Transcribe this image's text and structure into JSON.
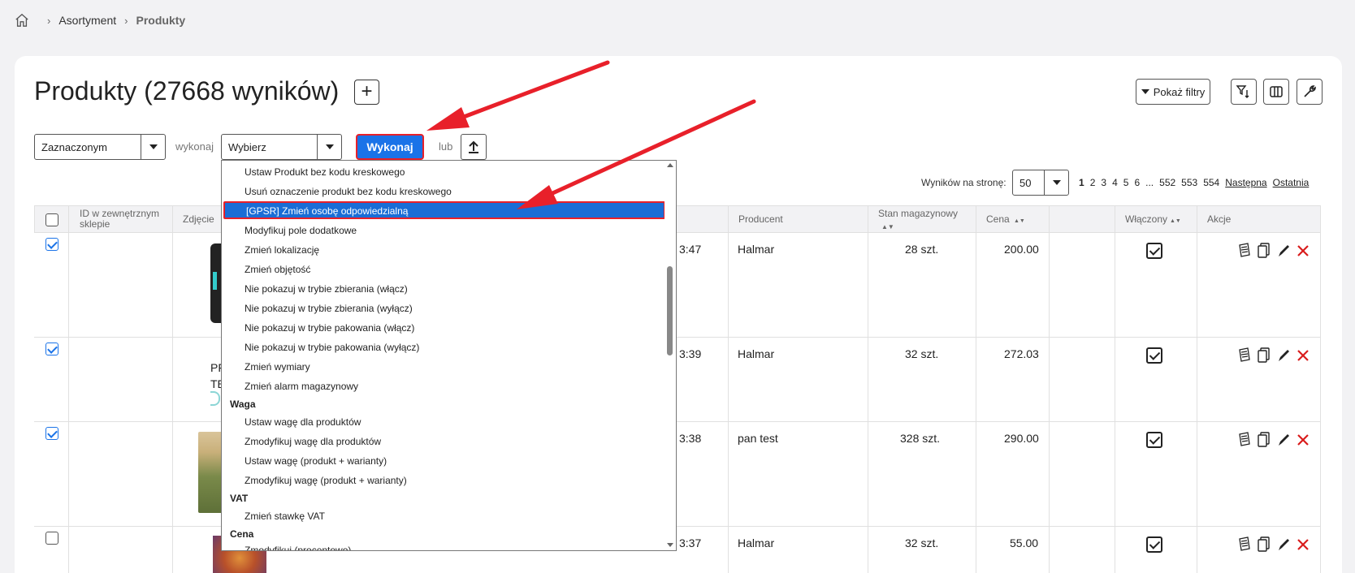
{
  "breadcrumb": {
    "items": [
      "Asortyment",
      "Produkty"
    ]
  },
  "header": {
    "title": "Produkty (27668 wyników)",
    "add_label": "+",
    "filters_label": "Pokaż filtry"
  },
  "bulk": {
    "scope_value": "Zaznaczonym",
    "do_label": "wykonaj",
    "action_value": "Wybierz",
    "execute_label": "Wykonaj",
    "or_label": "lub"
  },
  "pagination": {
    "perpage_label": "Wyników na stronę:",
    "perpage_value": "50",
    "pages": [
      "1",
      "2",
      "3",
      "4",
      "5",
      "6",
      "...",
      "552",
      "553",
      "554"
    ],
    "next": "Następna",
    "last": "Ostatnia"
  },
  "table": {
    "headers": {
      "external_id": "ID w zewnętrznym sklepie",
      "photo": "Zdjęcie",
      "producer": "Producent",
      "stock": "Stan magazynowy",
      "price": "Cena",
      "enabled": "Włączony",
      "actions": "Akcje"
    },
    "rows": [
      {
        "time": "3:47",
        "producer": "Halmar",
        "stock": "28 szt.",
        "price": "200.00"
      },
      {
        "time": "3:39",
        "producer": "Halmar",
        "stock": "32 szt.",
        "price": "272.03",
        "photo_text": "PF\nTE"
      },
      {
        "time": "3:38",
        "producer": "pan test",
        "stock": "328 szt.",
        "price": "290.00"
      },
      {
        "time": "3:37",
        "producer": "Halmar",
        "stock": "32 szt.",
        "price": "55.00"
      }
    ]
  },
  "dropdown": {
    "items": [
      {
        "type": "item",
        "label": "Ustaw Produkt bez kodu kreskowego"
      },
      {
        "type": "item",
        "label": "Usuń oznaczenie produkt bez kodu kreskowego"
      },
      {
        "type": "selected",
        "label": "[GPSR] Zmień osobę odpowiedzialną"
      },
      {
        "type": "item",
        "label": "Modyfikuj pole dodatkowe"
      },
      {
        "type": "item",
        "label": "Zmień lokalizację"
      },
      {
        "type": "item",
        "label": "Zmień objętość"
      },
      {
        "type": "item",
        "label": "Nie pokazuj w trybie zbierania (włącz)"
      },
      {
        "type": "item",
        "label": "Nie pokazuj w trybie zbierania (wyłącz)"
      },
      {
        "type": "item",
        "label": "Nie pokazuj w trybie pakowania (włącz)"
      },
      {
        "type": "item",
        "label": "Nie pokazuj w trybie pakowania (wyłącz)"
      },
      {
        "type": "item",
        "label": "Zmień wymiary"
      },
      {
        "type": "item",
        "label": "Zmień alarm magazynowy"
      },
      {
        "type": "group",
        "label": "Waga"
      },
      {
        "type": "item",
        "label": "Ustaw wagę dla produktów"
      },
      {
        "type": "item",
        "label": "Zmodyfikuj wagę dla produktów"
      },
      {
        "type": "item",
        "label": "Ustaw wagę (produkt + warianty)"
      },
      {
        "type": "item",
        "label": "Zmodyfikuj wagę (produkt + warianty)"
      },
      {
        "type": "group",
        "label": "VAT"
      },
      {
        "type": "item",
        "label": "Zmień stawkę VAT"
      },
      {
        "type": "group",
        "label": "Cena"
      },
      {
        "type": "item",
        "label": "Zmodyfikuj (procentowo)"
      }
    ]
  },
  "colors": {
    "primary": "#1a73e8",
    "highlight": "#1a6dd6",
    "annotation": "#e8202a",
    "delete": "#d91c1c"
  }
}
